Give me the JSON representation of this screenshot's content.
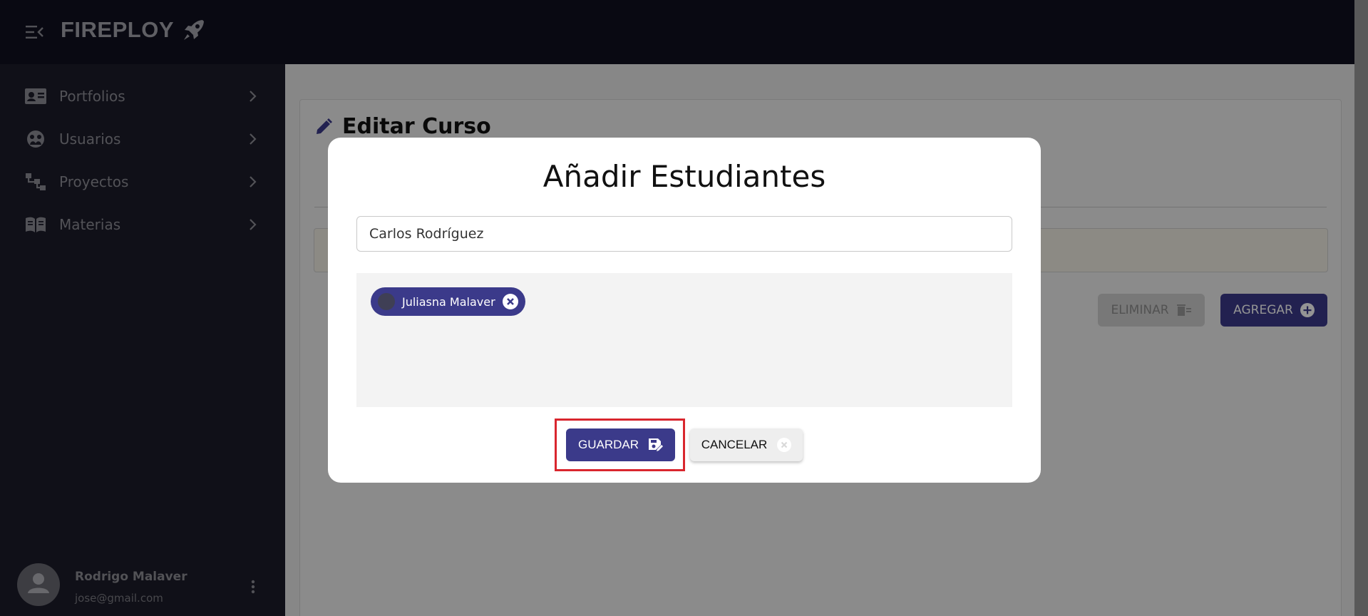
{
  "app": {
    "brand": "FIREPLOY"
  },
  "sidebar": {
    "items": [
      {
        "label": "Portfolios",
        "icon": "id-card-icon"
      },
      {
        "label": "Usuarios",
        "icon": "users-icon"
      },
      {
        "label": "Proyectos",
        "icon": "sitemap-icon"
      },
      {
        "label": "Materias",
        "icon": "book-icon"
      }
    ],
    "user": {
      "name": "Rodrigo Malaver",
      "email": "jose@gmail.com"
    }
  },
  "main": {
    "title": "Editar Curso",
    "buttons": {
      "eliminar": "ELIMINAR",
      "agregar": "AGREGAR"
    }
  },
  "modal": {
    "title": "Añadir Estudiantes",
    "search_value": "Carlos Rodríguez",
    "selected_students": [
      "Juliasna Malaver"
    ],
    "save_label": "GUARDAR",
    "cancel_label": "CANCELAR"
  },
  "colors": {
    "primary": "#3b3a8a",
    "topbar": "#111120",
    "sidebar": "#1c1c2a",
    "highlight": "#d9262e"
  }
}
